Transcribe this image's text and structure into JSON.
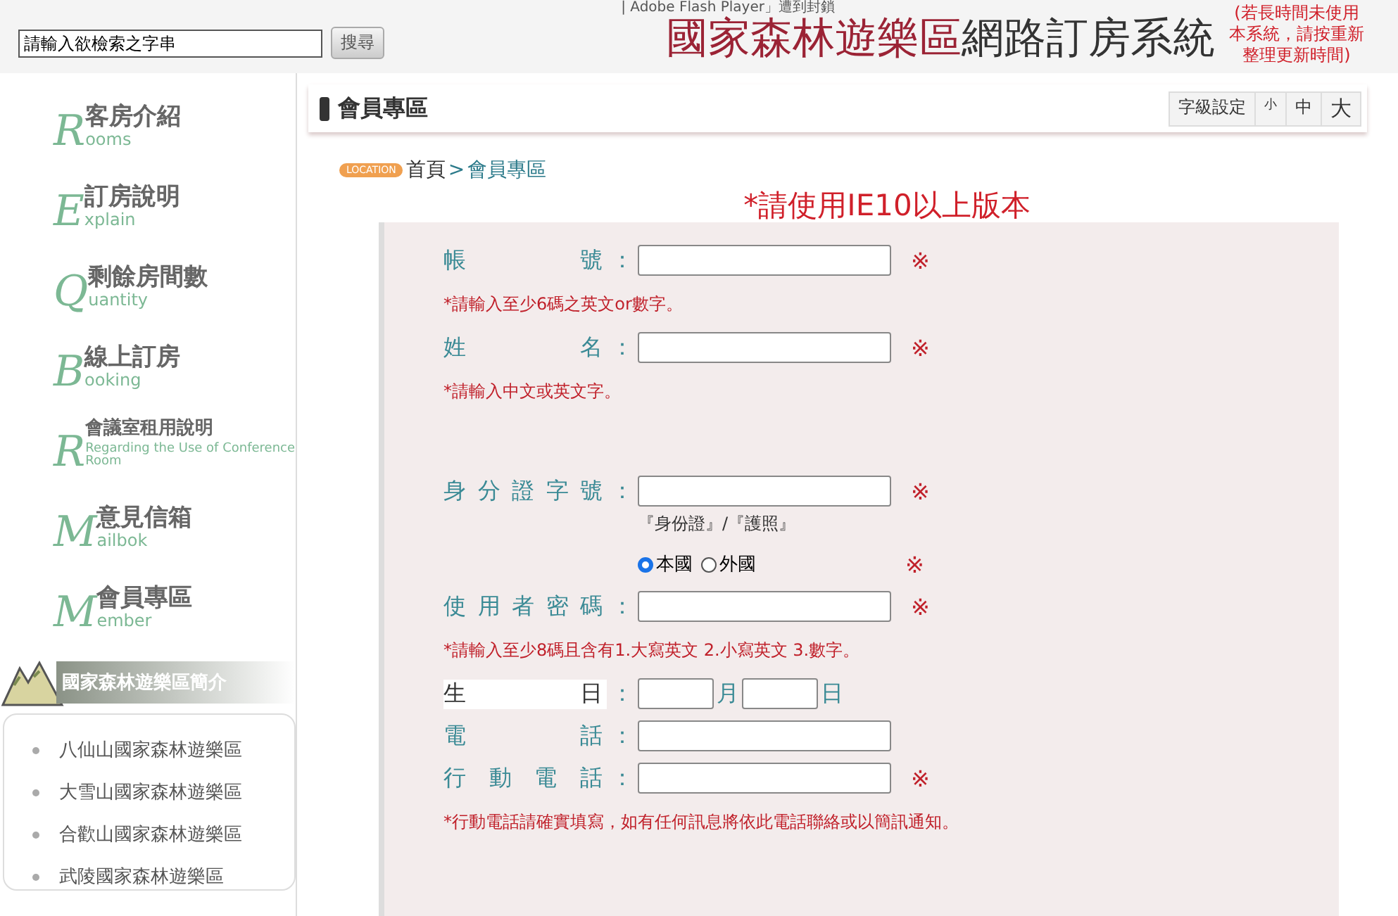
{
  "header": {
    "search": {
      "placeholder": "請輸入欲檢索之字串"
    },
    "search_button": "搜尋",
    "notice": "| Adobe Flash Player」遭到封鎖",
    "title_red": "國家森林遊樂區",
    "title_dark": "網路訂房系統",
    "refresh_note": "(若長時間未使用本系統，請按重新整理更新時間)"
  },
  "sidebar": {
    "items": [
      {
        "kind": "normal",
        "initial": "R",
        "rest": "ooms",
        "title": "客房介紹"
      },
      {
        "kind": "normal",
        "initial": "E",
        "rest": "xplain",
        "title": "訂房說明"
      },
      {
        "kind": "normal",
        "initial": "Q",
        "rest": "uantity",
        "title": "剩餘房間數"
      },
      {
        "kind": "normal",
        "initial": "B",
        "rest": "ooking",
        "title": "線上訂房"
      },
      {
        "kind": "small",
        "initial": "R",
        "rest": "Regarding the Use of Conference Room",
        "title": "會議室租用說明"
      },
      {
        "kind": "normal",
        "initial": "M",
        "rest": "ailbok",
        "title": "意見信箱"
      },
      {
        "kind": "normal",
        "initial": "M",
        "rest": "ember",
        "title": "會員專區"
      }
    ],
    "section_title": "國家森林遊樂區簡介",
    "parks": [
      "八仙山國家森林遊樂區",
      "大雪山國家森林遊樂區",
      "合歡山國家森林遊樂區",
      "武陵國家森林遊樂區"
    ]
  },
  "main": {
    "title": "會員專區",
    "font_size": {
      "label": "字級設定",
      "sizes": [
        "小",
        "中",
        "大"
      ]
    },
    "breadcrumb": {
      "badge": "LOCATION",
      "home": "首頁",
      "separator": ">",
      "current": "會員專區"
    },
    "browser_notice": "*請使用IE10以上版本",
    "rows": [
      {
        "kind": "text",
        "label": "帳號",
        "colon": "：",
        "required": "※",
        "hint": "*請輸入至少6碼之英文or數字。"
      },
      {
        "kind": "text",
        "label": "姓名",
        "colon": "：",
        "required": "※",
        "hint": "*請輸入中文或英文字。"
      },
      {
        "kind": "text",
        "label": "身分證字號",
        "colon": "：",
        "required": "※",
        "note": "『身份證』/『護照』"
      },
      {
        "kind": "radio",
        "required": "※",
        "options": [
          {
            "label": "本國",
            "selected": true
          },
          {
            "label": "外國",
            "selected": false
          }
        ]
      },
      {
        "kind": "text",
        "label": "使用者密碼",
        "colon": "：",
        "required": "※",
        "hint": "*請輸入至少8碼且含有1.大寫英文 2.小寫英文 3.數字。"
      },
      {
        "kind": "date",
        "label": "生日",
        "colon": "：",
        "units": [
          "月",
          "日"
        ]
      },
      {
        "kind": "text",
        "label": "電話",
        "colon": "："
      },
      {
        "kind": "text",
        "label": "行動電話",
        "colon": "：",
        "required": "※",
        "hint": "*行動電話請確實填寫，如有任何訊息將依此電話聯絡或以簡訊通知。"
      }
    ]
  }
}
